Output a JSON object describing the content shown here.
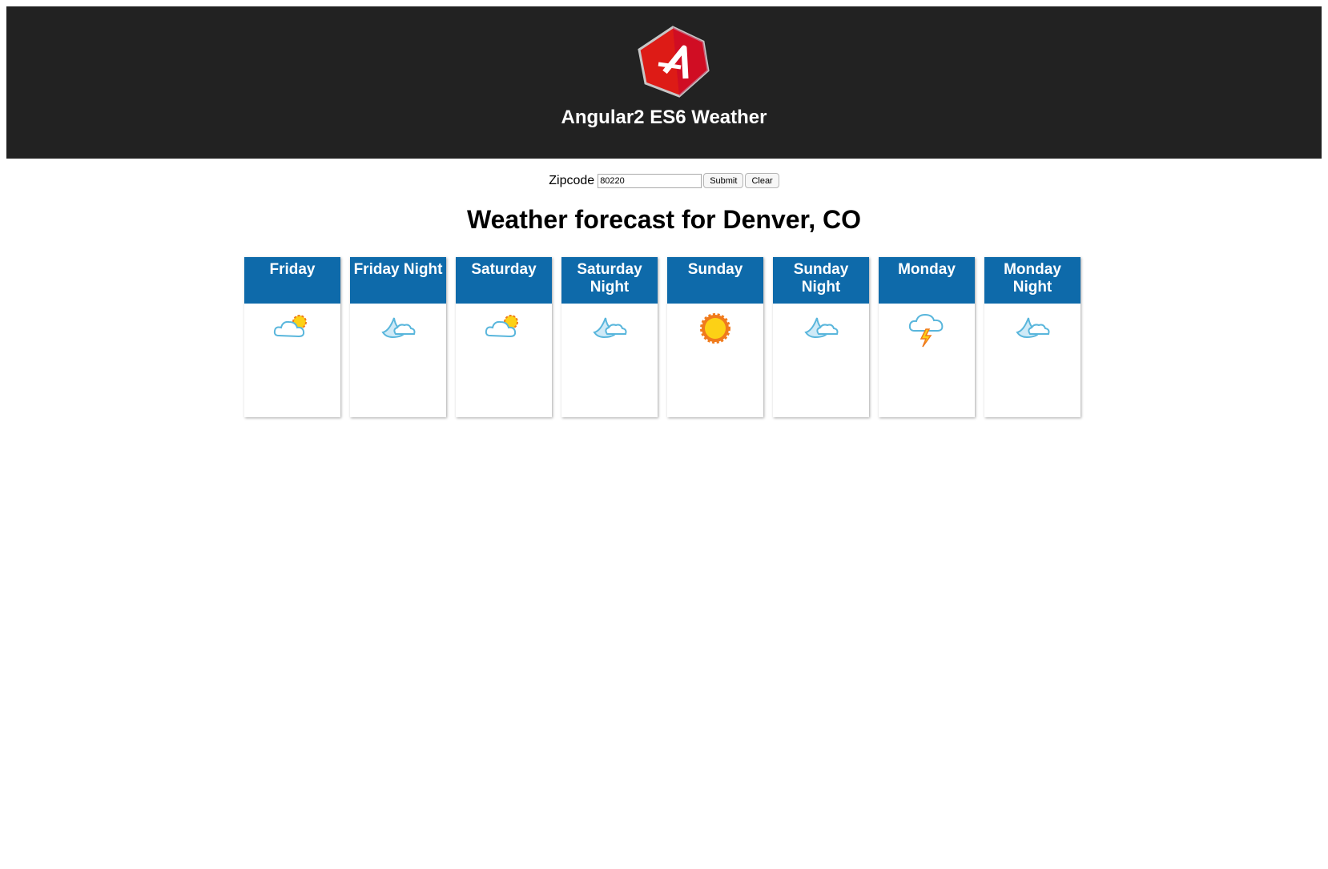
{
  "header": {
    "title": "Angular2 ES6 Weather",
    "logo_icon": "angular-logo-icon"
  },
  "form": {
    "label": "Zipcode",
    "zipcode_value": "80220",
    "submit_label": "Submit",
    "clear_label": "Clear"
  },
  "forecast": {
    "title": "Weather forecast for Denver, CO",
    "periods": [
      {
        "name": "Friday",
        "icon": "partly-cloudy-day-icon"
      },
      {
        "name": "Friday Night",
        "icon": "partly-cloudy-night-icon"
      },
      {
        "name": "Saturday",
        "icon": "partly-cloudy-day-icon"
      },
      {
        "name": "Saturday Night",
        "icon": "partly-cloudy-night-icon"
      },
      {
        "name": "Sunday",
        "icon": "sunny-icon"
      },
      {
        "name": "Sunday Night",
        "icon": "partly-cloudy-night-icon"
      },
      {
        "name": "Monday",
        "icon": "thunderstorm-icon"
      },
      {
        "name": "Monday Night",
        "icon": "partly-cloudy-night-icon"
      }
    ]
  },
  "colors": {
    "header_bg": "#222222",
    "card_header_bg": "#0e6aaa",
    "logo_red": "#dd1b16"
  }
}
